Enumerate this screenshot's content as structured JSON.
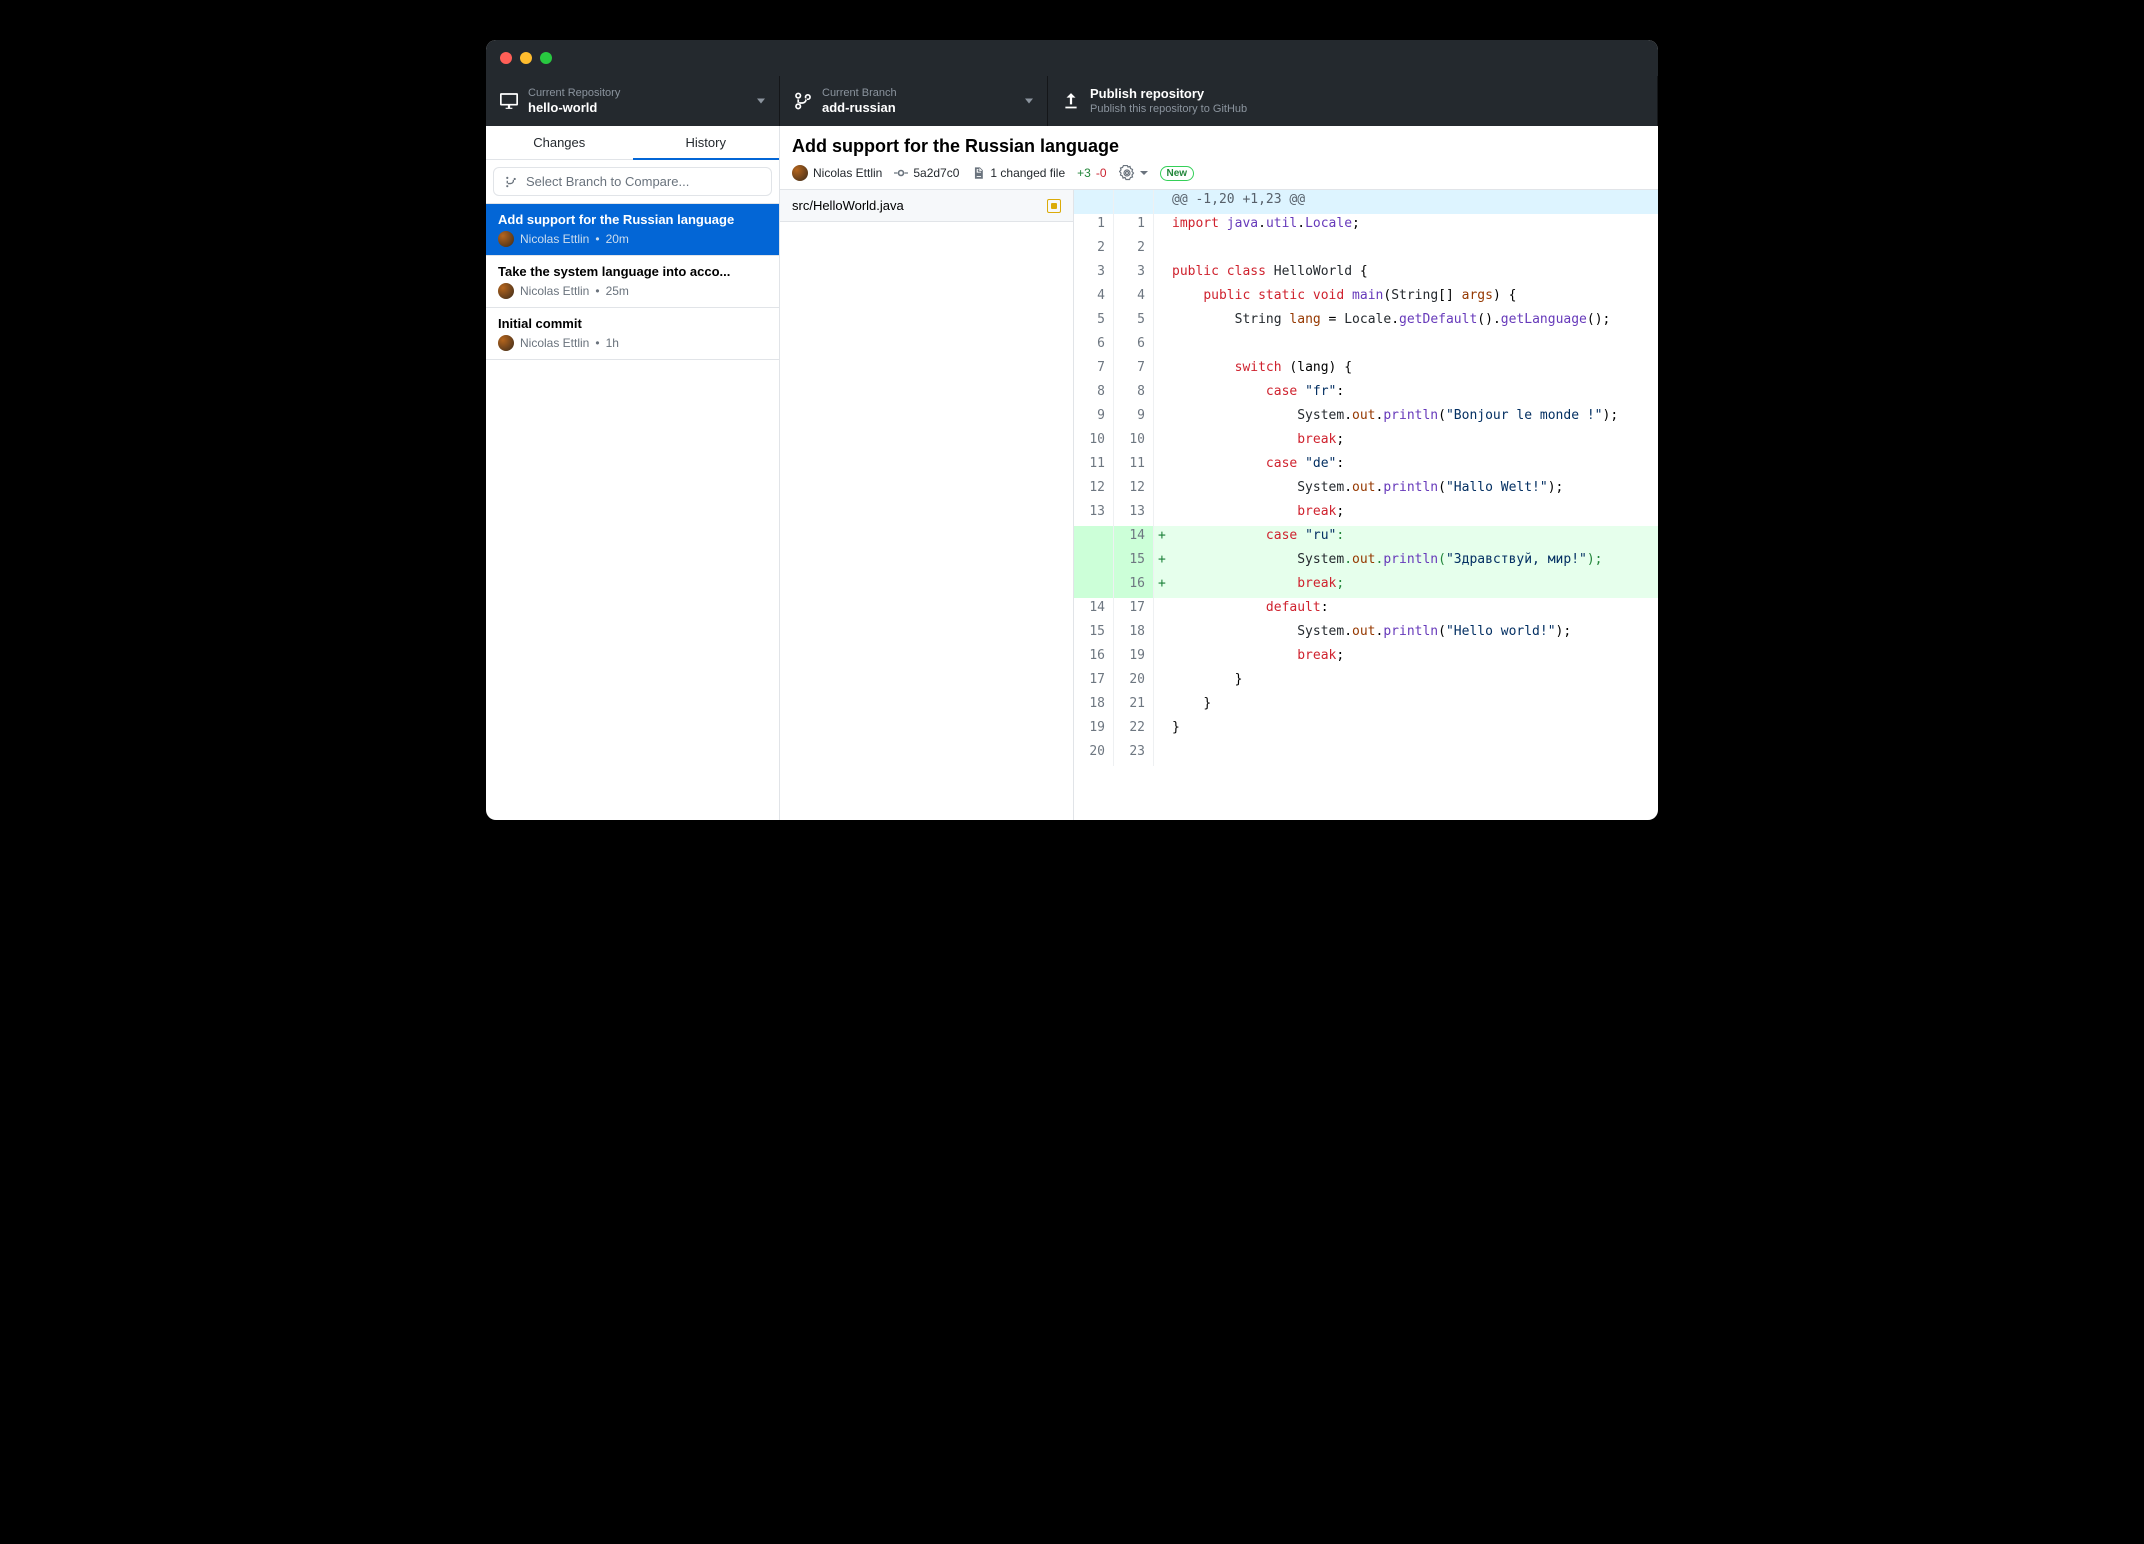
{
  "toolbar": {
    "repo": {
      "label": "Current Repository",
      "value": "hello-world"
    },
    "branch": {
      "label": "Current Branch",
      "value": "add-russian"
    },
    "publish": {
      "title": "Publish repository",
      "desc": "Publish this repository to GitHub"
    }
  },
  "tabs": {
    "changes": "Changes",
    "history": "History"
  },
  "compare_placeholder": "Select Branch to Compare...",
  "commits": [
    {
      "title": "Add support for the Russian language",
      "author": "Nicolas Ettlin",
      "time": "20m",
      "selected": true
    },
    {
      "title": "Take the system language into acco...",
      "author": "Nicolas Ettlin",
      "time": "25m",
      "selected": false
    },
    {
      "title": "Initial commit",
      "author": "Nicolas Ettlin",
      "time": "1h",
      "selected": false
    }
  ],
  "commit_detail": {
    "title": "Add support for the Russian language",
    "author": "Nicolas Ettlin",
    "sha": "5a2d7c0",
    "files_label": "1 changed file",
    "additions": "+3",
    "deletions": "-0",
    "new_badge": "New"
  },
  "file": {
    "path": "src/HelloWorld.java"
  },
  "diff": [
    {
      "type": "hunk",
      "old": "",
      "new": "",
      "text": "@@ -1,20 +1,23 @@"
    },
    {
      "type": "ctx",
      "old": "1",
      "new": "1",
      "html": "<span class='k'>import</span> <span class='f'>java</span>.<span class='f'>util</span>.<span class='f'>Locale</span>;"
    },
    {
      "type": "ctx",
      "old": "2",
      "new": "2",
      "html": ""
    },
    {
      "type": "ctx",
      "old": "3",
      "new": "3",
      "html": "<span class='k'>public</span> <span class='k'>class</span> <span class='t'>HelloWorld</span> {"
    },
    {
      "type": "ctx",
      "old": "4",
      "new": "4",
      "html": "    <span class='k'>public</span> <span class='k'>static</span> <span class='k'>void</span> <span class='f'>main</span>(<span class='t'>String</span>[] <span class='v'>args</span>) {"
    },
    {
      "type": "ctx",
      "old": "5",
      "new": "5",
      "html": "        <span class='t'>String</span> <span class='v'>lang</span> = <span class='t'>Locale</span>.<span class='f'>getDefault</span>().<span class='f'>getLanguage</span>();"
    },
    {
      "type": "ctx",
      "old": "6",
      "new": "6",
      "html": ""
    },
    {
      "type": "ctx",
      "old": "7",
      "new": "7",
      "html": "        <span class='k'>switch</span> (lang) {"
    },
    {
      "type": "ctx",
      "old": "8",
      "new": "8",
      "html": "            <span class='k'>case</span> <span class='s'>\"fr\"</span>:"
    },
    {
      "type": "ctx",
      "old": "9",
      "new": "9",
      "html": "                <span class='t'>System</span>.<span class='v'>out</span>.<span class='f'>println</span>(<span class='s'>\"Bonjour le monde !\"</span>);"
    },
    {
      "type": "ctx",
      "old": "10",
      "new": "10",
      "html": "                <span class='k'>break</span>;"
    },
    {
      "type": "ctx",
      "old": "11",
      "new": "11",
      "html": "            <span class='k'>case</span> <span class='s'>\"de\"</span>:"
    },
    {
      "type": "ctx",
      "old": "12",
      "new": "12",
      "html": "                <span class='t'>System</span>.<span class='v'>out</span>.<span class='f'>println</span>(<span class='s'>\"Hallo Welt!\"</span>);"
    },
    {
      "type": "ctx",
      "old": "13",
      "new": "13",
      "html": "                <span class='k'>break</span>;"
    },
    {
      "type": "add",
      "old": "",
      "new": "14",
      "html": "            <span class='k'>case</span> <span class='s'>\"ru\"</span>:"
    },
    {
      "type": "add",
      "old": "",
      "new": "15",
      "html": "                <span class='t'>System</span>.<span class='v'>out</span>.<span class='f'>println</span>(<span class='s'>\"Здравствуй, мир!\"</span>);"
    },
    {
      "type": "add",
      "old": "",
      "new": "16",
      "html": "                <span class='k'>break</span>;"
    },
    {
      "type": "ctx",
      "old": "14",
      "new": "17",
      "html": "            <span class='k'>default</span>:"
    },
    {
      "type": "ctx",
      "old": "15",
      "new": "18",
      "html": "                <span class='t'>System</span>.<span class='v'>out</span>.<span class='f'>println</span>(<span class='s'>\"Hello world!\"</span>);"
    },
    {
      "type": "ctx",
      "old": "16",
      "new": "19",
      "html": "                <span class='k'>break</span>;"
    },
    {
      "type": "ctx",
      "old": "17",
      "new": "20",
      "html": "        }"
    },
    {
      "type": "ctx",
      "old": "18",
      "new": "21",
      "html": "    }"
    },
    {
      "type": "ctx",
      "old": "19",
      "new": "22",
      "html": "}"
    },
    {
      "type": "ctx",
      "old": "20",
      "new": "23",
      "html": ""
    }
  ]
}
